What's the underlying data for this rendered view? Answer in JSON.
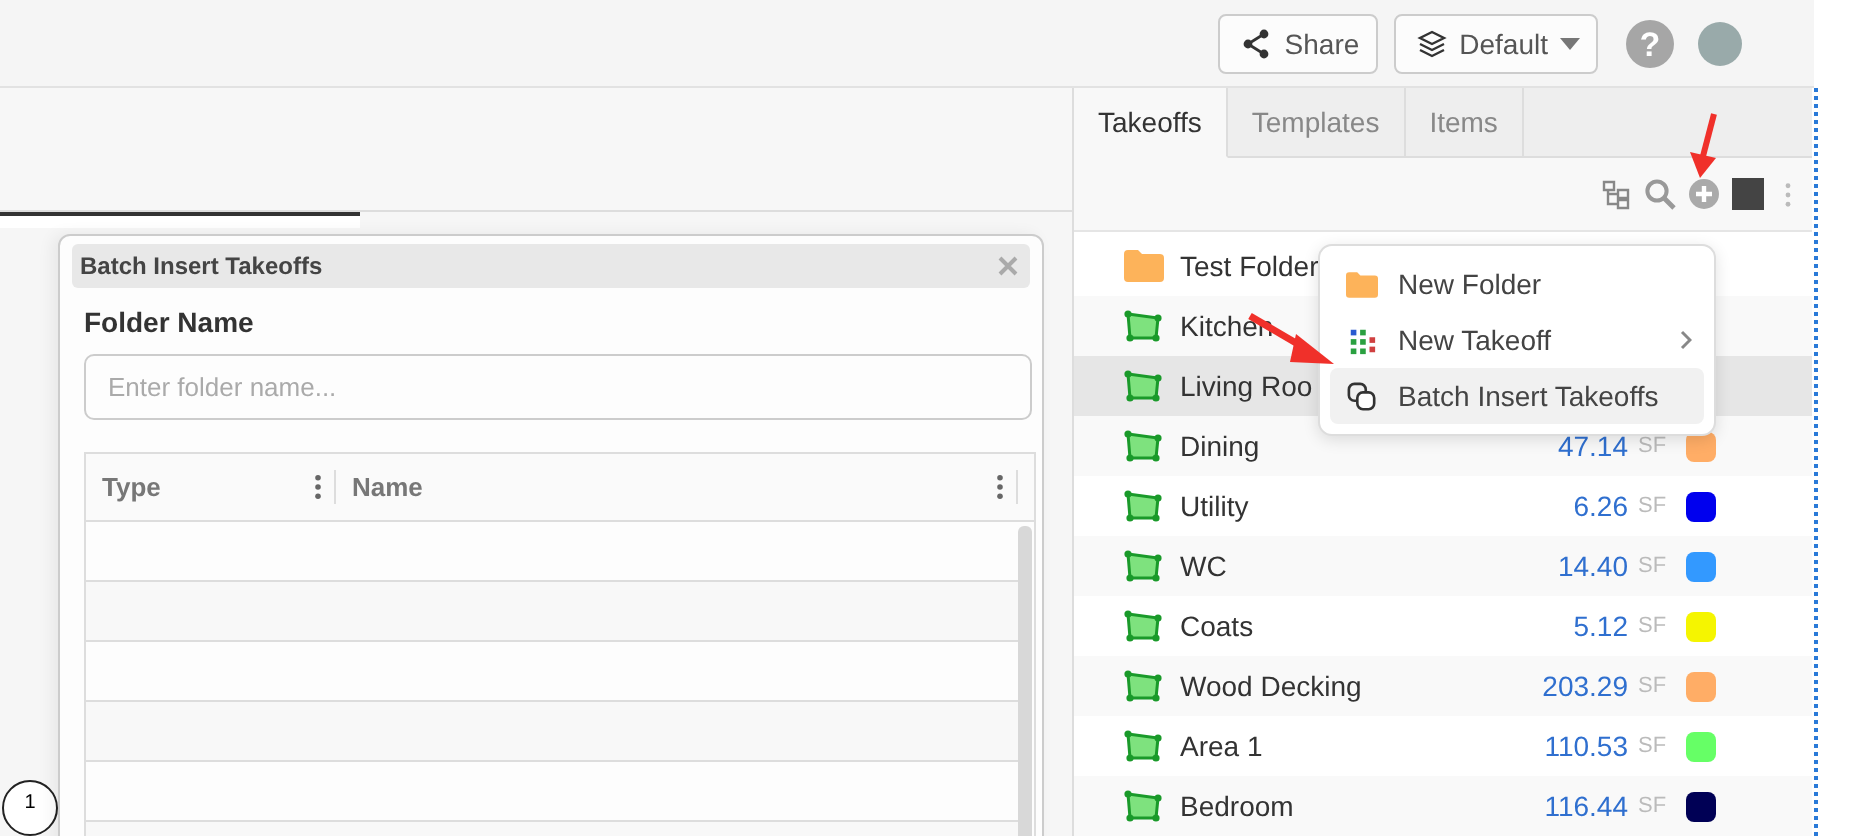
{
  "top_bar": {
    "share_button": "Share",
    "layout_dropdown": "Default",
    "help_label": "?"
  },
  "panel": {
    "tabs": [
      {
        "label": "Takeoffs",
        "selected": true
      },
      {
        "label": "Templates",
        "selected": false
      },
      {
        "label": "Items",
        "selected": false
      }
    ],
    "takeoffs": [
      {
        "kind": "folder",
        "name": "Test Folder",
        "selected": false
      },
      {
        "kind": "area",
        "name": "Kitchen",
        "selected": false
      },
      {
        "kind": "area",
        "name": "Living Roo",
        "selected": true
      },
      {
        "kind": "area",
        "name": "Dining",
        "value": "47.14",
        "unit": "SF",
        "color": "#ffad66",
        "selected": false
      },
      {
        "kind": "area",
        "name": "Utility",
        "value": "6.26",
        "unit": "SF",
        "color": "#0000ee",
        "selected": false
      },
      {
        "kind": "area",
        "name": "WC",
        "value": "14.40",
        "unit": "SF",
        "color": "#3399ff",
        "selected": false
      },
      {
        "kind": "area",
        "name": "Coats",
        "value": "5.12",
        "unit": "SF",
        "color": "#f5f500",
        "selected": false
      },
      {
        "kind": "area",
        "name": "Wood Decking",
        "value": "203.29",
        "unit": "SF",
        "color": "#ffad66",
        "selected": false
      },
      {
        "kind": "area",
        "name": "Area 1",
        "value": "110.53",
        "unit": "SF",
        "color": "#66ff66",
        "selected": false
      },
      {
        "kind": "area",
        "name": "Bedroom",
        "value": "116.44",
        "unit": "SF",
        "color": "#000055",
        "selected": false
      }
    ]
  },
  "add_menu": {
    "items": [
      {
        "kind": "folder",
        "label": "New Folder",
        "submenu": false,
        "selected": false
      },
      {
        "kind": "takeoff",
        "label": "New Takeoff",
        "submenu": true,
        "selected": false
      },
      {
        "kind": "batch",
        "label": "Batch Insert Takeoffs",
        "submenu": false,
        "selected": true
      }
    ]
  },
  "dialog": {
    "title": "Batch Insert Takeoffs",
    "folder_label": "Folder Name",
    "folder_field": {
      "placeholder": "Enter folder name..."
    },
    "table": {
      "columns": [
        "Type",
        "Name"
      ]
    }
  },
  "canvas_marker": "1"
}
